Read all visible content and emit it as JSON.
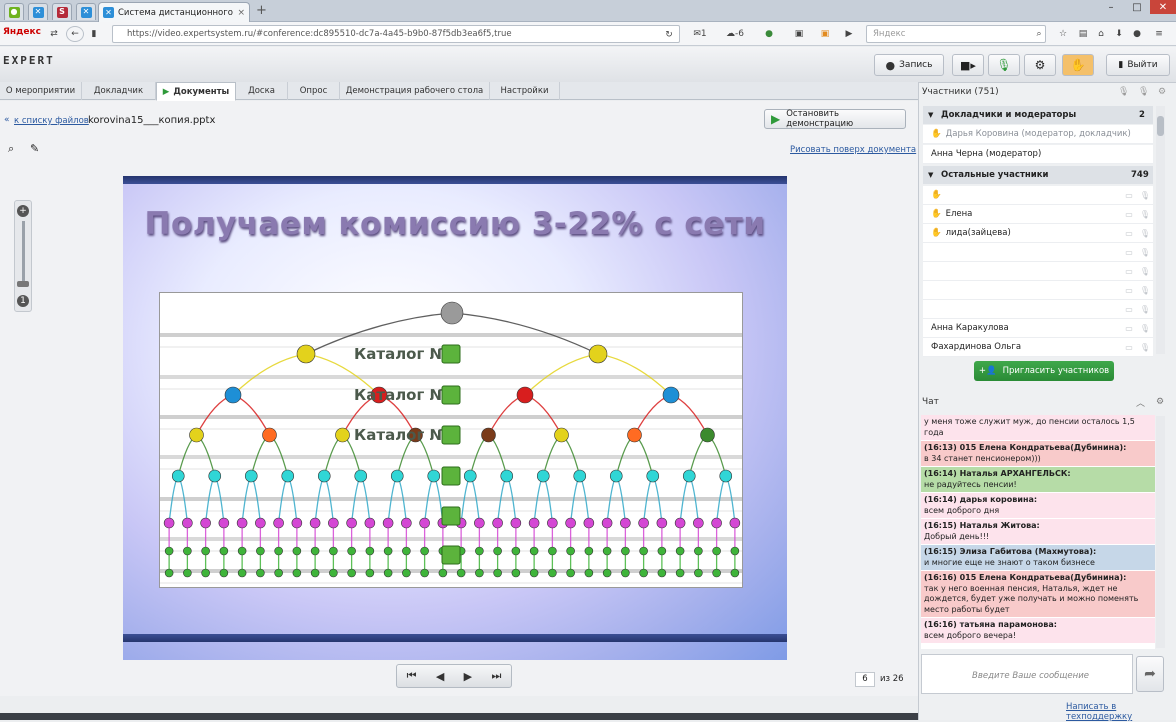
{
  "browser": {
    "brand": "Яндекс",
    "tab_title": "Система дистанционного обу...",
    "url": "https://video.expertsystem.ru/#conference:dc895510-dc7a-4a45-b9b0-87f5db3ea6f5,true",
    "search_placeholder": "Яндекс",
    "mail_count": "1",
    "weather": "-6"
  },
  "app": {
    "logo": "EXPERT",
    "record_label": "Запись",
    "exit_label": "Выйти"
  },
  "nav_tabs": [
    "О мероприятии",
    "Докладчик",
    "Документы",
    "Доска",
    "Опрос",
    "Демонстрация рабочего стола",
    "Настройки"
  ],
  "doc": {
    "back_link": "к списку файлов",
    "file_name": "korovina15___копия.pptx",
    "stop_demo": "Остановить демонстрацию",
    "draw_link": "Рисовать поверх документа",
    "page_current": "6",
    "page_total": "из 26"
  },
  "slide": {
    "title": "Получаем комиссию 3-22% с сети",
    "catalog_label": "Каталог №"
  },
  "participants": {
    "header": "Участники (751)",
    "group1": {
      "label": "Докладчики и модераторы",
      "count": "2"
    },
    "speakers": [
      "Дарья Коровина (модератор, докладчик)",
      "Анна Черна (модератор)"
    ],
    "group2": {
      "label": "Остальные участники",
      "count": "749"
    },
    "others": [
      "",
      "Елена",
      "лида(зайцева)",
      "",
      "",
      "",
      "",
      "Анна Каракулова",
      "Фахардинова Ольга"
    ],
    "invite": "Пригласить участников"
  },
  "chat": {
    "header": "Чат",
    "messages": [
      {
        "head": "",
        "text": "у меня тоже служит муж, до пенсии осталось 1,5 года",
        "color": "pink"
      },
      {
        "head": "(16:13) 015 Елена Кондратьева(Дубинина):",
        "text": "в 34 станет пенсионером)))",
        "color": "red"
      },
      {
        "head": "(16:14) Наталья АРХАНГЕЛЬСК:",
        "text": "не радуйтесь пенсии!",
        "color": "green"
      },
      {
        "head": "(16:14) дарья коровина:",
        "text": "всем доброго дня",
        "color": "pink"
      },
      {
        "head": "(16:15) Наталья Житова:",
        "text": "Добрый день!!!",
        "color": "pink"
      },
      {
        "head": "(16:15) Элиза Габитова (Махмутова):",
        "text": "и многие еще не знают о таком бизнесе",
        "color": "blue"
      },
      {
        "head": "(16:16) 015 Елена Кондратьева(Дубинина):",
        "text": "так у него военная пенсия, Наталья, ждет не дождется, будет уже получать и можно поменять место работы будет",
        "color": "red"
      },
      {
        "head": "(16:16) татьяна парамонова:",
        "text": "всем доброго вечера!",
        "color": "pink"
      }
    ],
    "input_placeholder": "Введите Ваше сообщение",
    "support_link": "Написать в техподдержку"
  }
}
